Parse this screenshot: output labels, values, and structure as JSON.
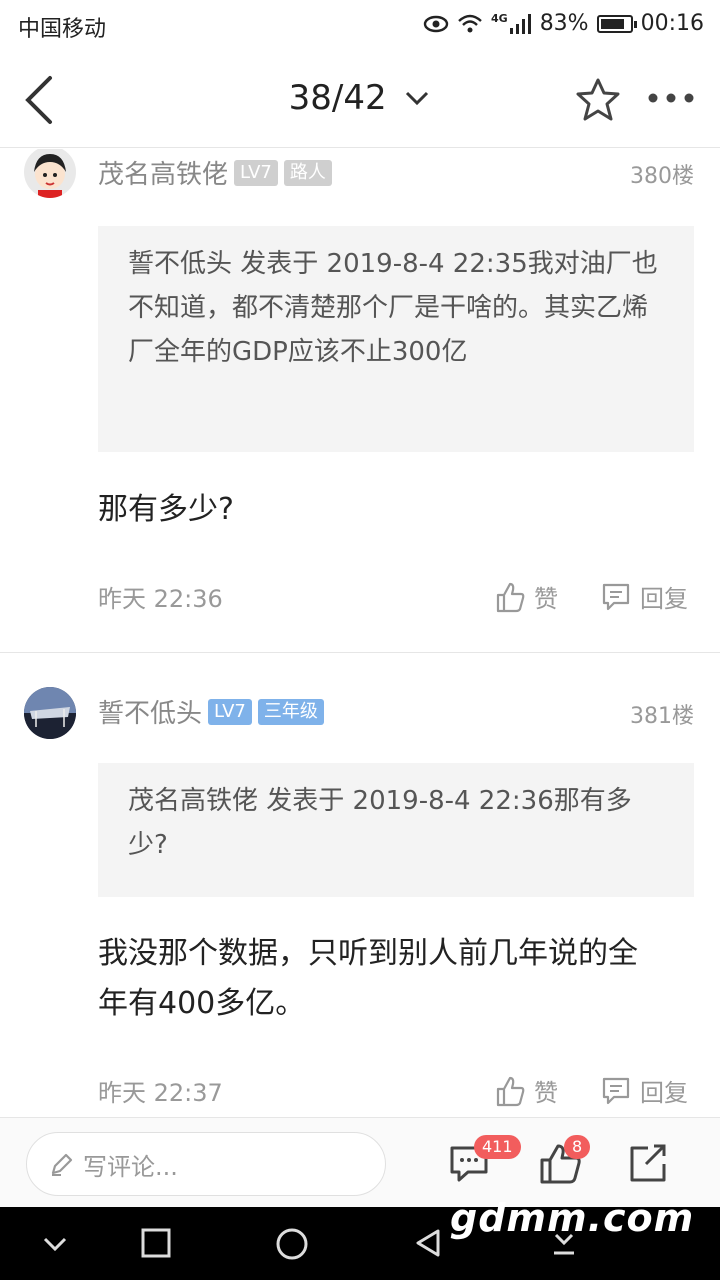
{
  "status": {
    "carrier": "中国移动",
    "network": "4G",
    "battery": "83%",
    "battery_level": 0.83,
    "time": "00:16"
  },
  "header": {
    "page_indicator": "38/42"
  },
  "posts": [
    {
      "user": "茂名高铁佬",
      "level": "LV7",
      "tag": "路人",
      "floor": "380楼",
      "quote": "誓不低头 发表于 2019-8-4 22:35我对油厂也不知道，都不清楚那个厂是干啥的。其实乙烯厂全年的GDP应该不止300亿",
      "body": "那有多少?",
      "time": "昨天 22:36",
      "like_label": "赞",
      "reply_label": "回复"
    },
    {
      "user": "誓不低头",
      "level": "LV7",
      "tag": "三年级",
      "floor": "381楼",
      "quote": "茂名高铁佬 发表于 2019-8-4 22:36那有多少?",
      "body": "我没那个数据，只听到别人前几年说的全年有400多亿。",
      "time": "昨天 22:37",
      "like_label": "赞",
      "reply_label": "回复"
    }
  ],
  "bottom_bar": {
    "comment_placeholder": "写评论...",
    "comment_count": "411",
    "like_count": "8"
  },
  "watermark": "gdmm.com",
  "colors": {
    "badge_gray": "#cfcfcf",
    "badge_blue": "#7fb2ea",
    "count_red": "#f25d5d"
  }
}
